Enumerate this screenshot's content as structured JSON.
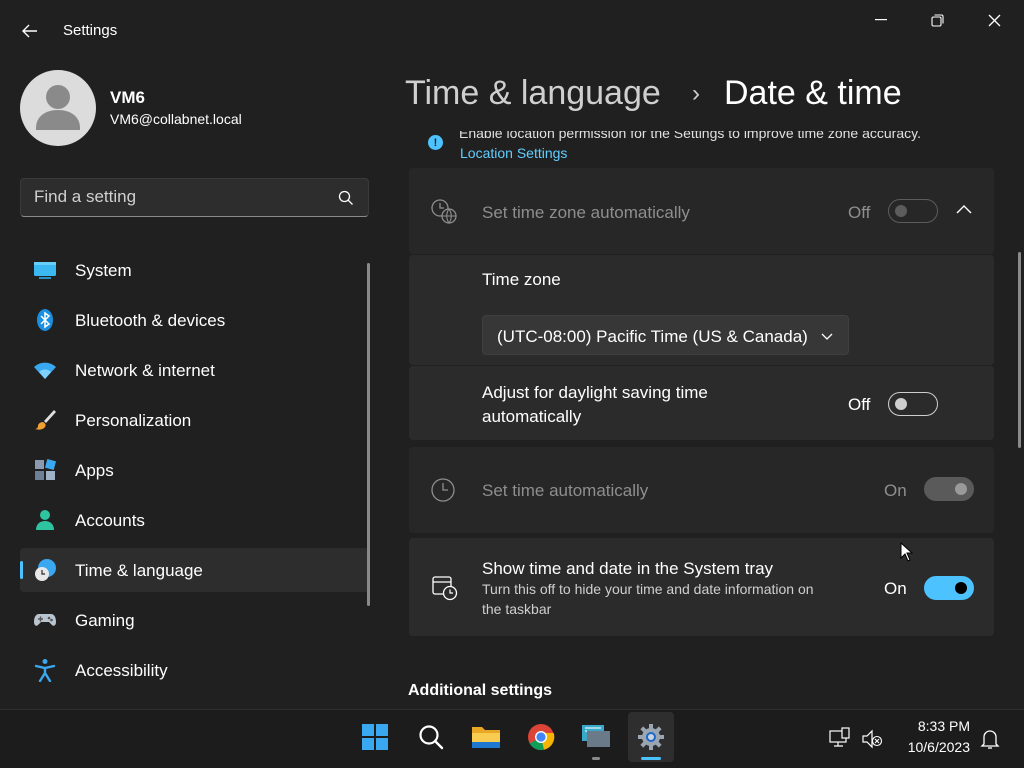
{
  "window": {
    "title": "Settings",
    "back_icon": "back-arrow-icon",
    "controls": [
      "minimize-icon",
      "maximize-icon",
      "close-icon"
    ]
  },
  "user": {
    "name": "VM6",
    "email": "VM6@collabnet.local"
  },
  "search": {
    "placeholder": "Find a setting",
    "icon": "search-icon"
  },
  "sidebar": {
    "items": [
      {
        "label": "System",
        "icon": "system-icon"
      },
      {
        "label": "Bluetooth & devices",
        "icon": "bluetooth-icon"
      },
      {
        "label": "Network & internet",
        "icon": "wifi-icon"
      },
      {
        "label": "Personalization",
        "icon": "brush-icon"
      },
      {
        "label": "Apps",
        "icon": "apps-icon"
      },
      {
        "label": "Accounts",
        "icon": "accounts-icon"
      },
      {
        "label": "Time & language",
        "icon": "time-language-icon",
        "active": true
      },
      {
        "label": "Gaming",
        "icon": "gaming-icon"
      },
      {
        "label": "Accessibility",
        "icon": "accessibility-icon"
      }
    ]
  },
  "header": {
    "parent": "Time & language",
    "separator": "›",
    "current": "Date & time"
  },
  "info": {
    "text": "Enable location permission for the Settings to improve time zone accuracy.",
    "link": "Location Settings"
  },
  "settings": {
    "auto_timezone": {
      "label": "Set time zone automatically",
      "state": "Off",
      "enabled": false,
      "expanded": true
    },
    "timezone": {
      "label": "Time zone",
      "value": "(UTC-08:00) Pacific Time (US & Canada)"
    },
    "daylight": {
      "label_line1": "Adjust for daylight saving time",
      "label_line2": "automatically",
      "state": "Off"
    },
    "auto_time": {
      "label": "Set time automatically",
      "state": "On",
      "enabled": false
    },
    "systray": {
      "label": "Show time and date in the System tray",
      "desc_line1": "Turn this off to hide your time and date information on",
      "desc_line2": "the taskbar",
      "state": "On"
    }
  },
  "sections": {
    "additional": "Additional settings"
  },
  "taskbar": {
    "apps": [
      "start-icon",
      "search-icon",
      "file-explorer-icon",
      "chrome-icon",
      "remote-desktop-icon",
      "settings-icon"
    ],
    "time": "8:33 PM",
    "date": "10/6/2023"
  },
  "colors": {
    "accent": "#4cc2ff",
    "link": "#60cdff",
    "background": "#202020",
    "card": "#2b2b2b"
  }
}
